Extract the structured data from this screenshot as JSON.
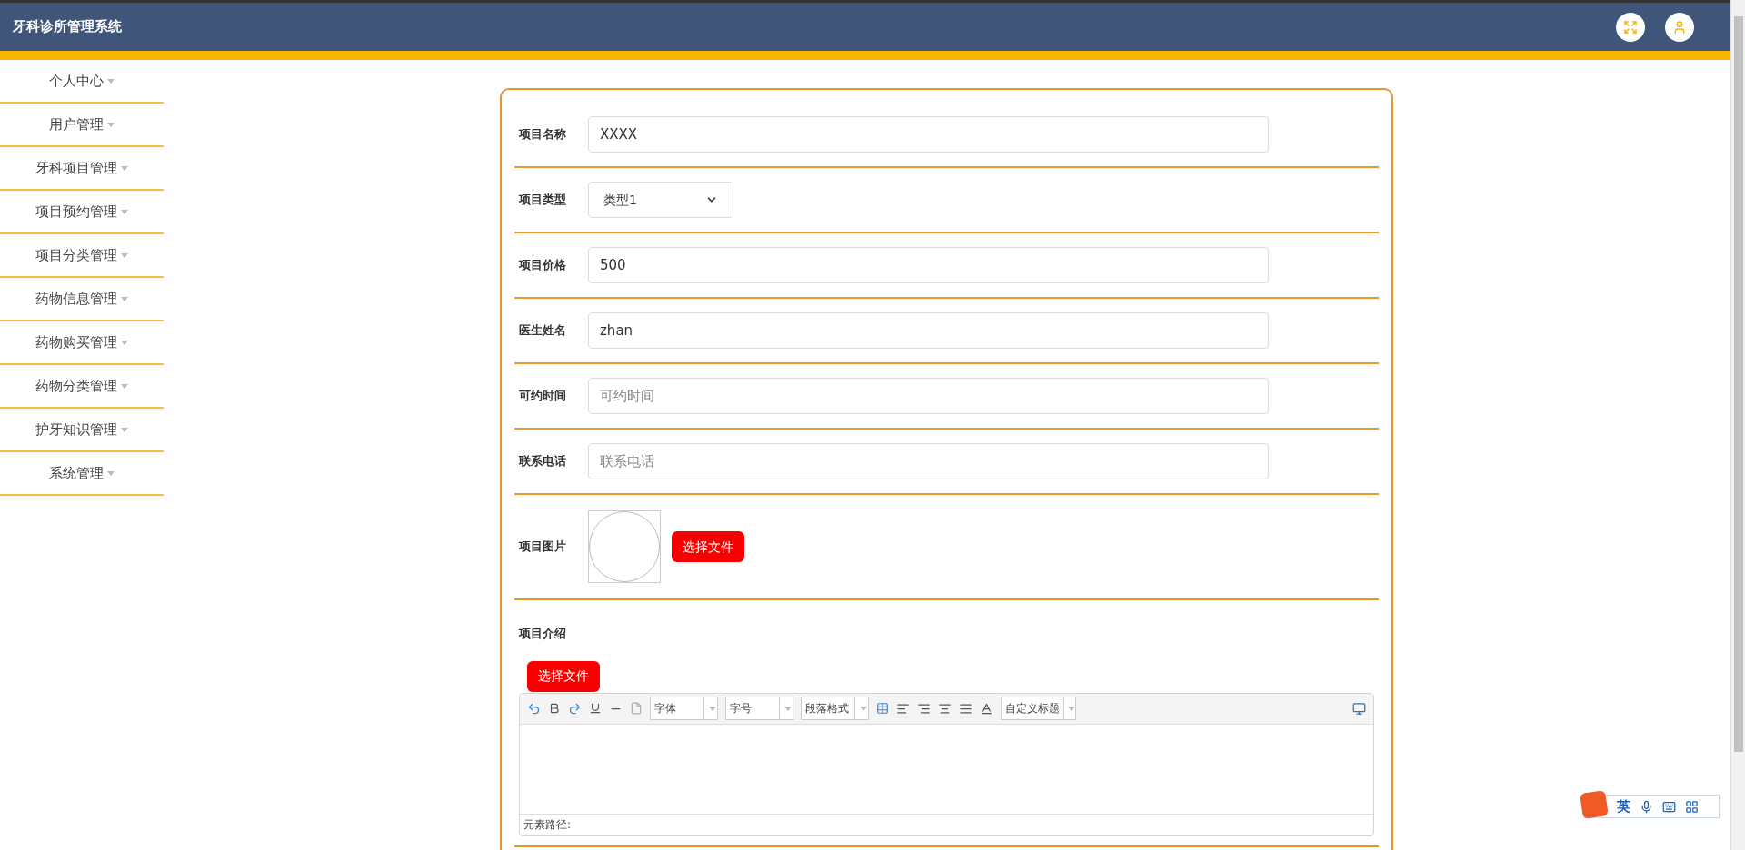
{
  "header": {
    "title": "牙科诊所管理系统"
  },
  "sidebar": {
    "items": [
      {
        "label": "个人中心"
      },
      {
        "label": "用户管理"
      },
      {
        "label": "牙科项目管理"
      },
      {
        "label": "项目预约管理"
      },
      {
        "label": "项目分类管理"
      },
      {
        "label": "药物信息管理"
      },
      {
        "label": "药物购买管理"
      },
      {
        "label": "药物分类管理"
      },
      {
        "label": "护牙知识管理"
      },
      {
        "label": "系统管理"
      }
    ]
  },
  "form": {
    "fields": [
      {
        "kind": "input",
        "label": "项目名称",
        "value": "XXXX"
      },
      {
        "kind": "select",
        "label": "项目类型",
        "value": "类型1"
      },
      {
        "kind": "input",
        "label": "项目价格",
        "value": "500"
      },
      {
        "kind": "input",
        "label": "医生姓名",
        "value": "zhan"
      },
      {
        "kind": "input",
        "label": "可约时间",
        "placeholder": "可约时间"
      },
      {
        "kind": "input",
        "label": "联系电话",
        "placeholder": "联系电话"
      },
      {
        "kind": "image",
        "label": "项目图片",
        "button": "选择文件"
      }
    ],
    "intro": {
      "label": "项目介绍",
      "button": "选择文件",
      "editor": {
        "selects": [
          "字体",
          "字号",
          "段落格式"
        ],
        "heading_select": "自定义标题",
        "path_label": "元素路径:"
      }
    }
  },
  "ime_toolbar": {
    "mode": "英"
  }
}
